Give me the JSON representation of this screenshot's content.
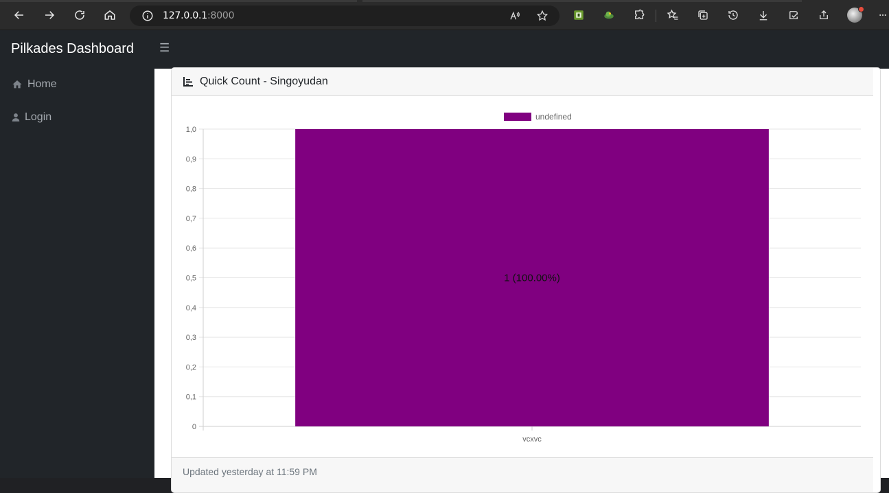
{
  "browser": {
    "url_host": "127.0.0.1",
    "url_port": ":8000"
  },
  "navbar": {
    "brand": "Pilkades Dashboard",
    "toggler_icon": "hamburger-icon"
  },
  "sidebar": {
    "items": [
      {
        "label": "Home",
        "icon": "home-icon"
      },
      {
        "label": "Login",
        "icon": "user-icon"
      }
    ]
  },
  "card": {
    "title": "Quick Count - Singoyudan",
    "title_icon": "chart-bar-icon",
    "footer": "Updated yesterday at 11:59 PM"
  },
  "chart_data": {
    "type": "bar",
    "categories": [
      "vcxvc"
    ],
    "series": [
      {
        "name": "undefined",
        "values": [
          1
        ],
        "color": "#800080"
      }
    ],
    "data_labels": [
      "1 (100.00%)"
    ],
    "ylim": [
      0,
      1
    ],
    "yticks": [
      "0",
      "0,1",
      "0,2",
      "0,3",
      "0,4",
      "0,5",
      "0,6",
      "0,7",
      "0,8",
      "0,9",
      "1,0"
    ],
    "legend": "top",
    "grid": true,
    "title": "",
    "xlabel": "",
    "ylabel": ""
  }
}
